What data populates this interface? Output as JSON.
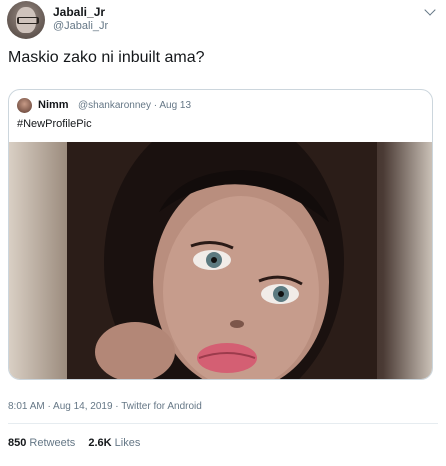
{
  "tweet": {
    "author_name": "Jabali_Jr",
    "author_handle": "@Jabali_Jr",
    "text": "Maskio zako ni inbuilt ama?",
    "timestamp": "8:01 AM · Aug 14, 2019 · Twitter for Android",
    "retweets_count": "850",
    "retweets_label": "Retweets",
    "likes_count": "2.6K",
    "likes_label": "Likes"
  },
  "quoted": {
    "author_name": "Nimm",
    "author_handle": "@shankaronney",
    "date": "Aug 13",
    "separator": "·",
    "text": "#NewProfilePic"
  },
  "colors": {
    "text": "#14171a",
    "secondary": "#657786",
    "border": "#ccd6dd"
  },
  "icons": {
    "menu": "chevron-down-icon"
  }
}
